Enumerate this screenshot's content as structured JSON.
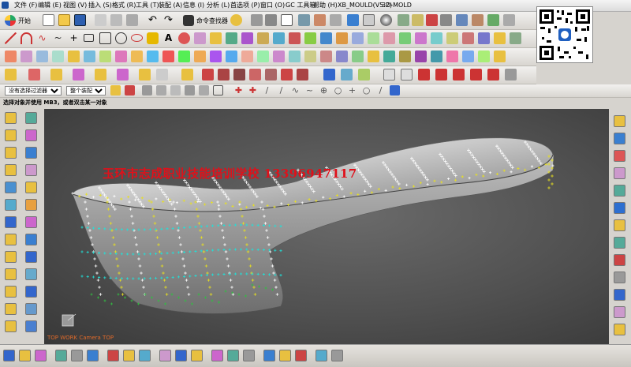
{
  "menubar": {
    "items": [
      {
        "label": "文件 (F)"
      },
      {
        "label": "编辑 (E)"
      },
      {
        "label": "视图 (V)"
      },
      {
        "label": "插入 (S)"
      },
      {
        "label": "格式 (R)"
      },
      {
        "label": "工具 (T)"
      },
      {
        "label": "装配 (A)"
      },
      {
        "label": "信息 (I)"
      },
      {
        "label": "分析 (L)"
      },
      {
        "label": "首选项 (P)"
      },
      {
        "label": "窗口 (O)"
      },
      {
        "label": "GC 工具箱"
      },
      {
        "label": "帮助 (H)"
      },
      {
        "label": "XB_MOULD(V5.2)"
      },
      {
        "label": "3D-MOLD"
      }
    ]
  },
  "toolbar": {
    "start_label": "开始",
    "command_finder_label": "命令查找器"
  },
  "selection": {
    "filter_value": "没有选择过滤器",
    "assembly_value": "整个装配"
  },
  "status": {
    "prompt": "选择对象并使用 MB3，或者双击某一对象"
  },
  "viewport": {
    "watermark": "玉环市志成职业技能培训学校 13396947117",
    "view_label": "TOP WORK  Camera TOP",
    "colors": {
      "watermark": "#e0101a",
      "surface": "#c8c8c8",
      "points_white": "#ffffff",
      "points_yellow": "#e8e020",
      "points_cyan": "#20e0d8",
      "points_green": "#30c040"
    }
  }
}
